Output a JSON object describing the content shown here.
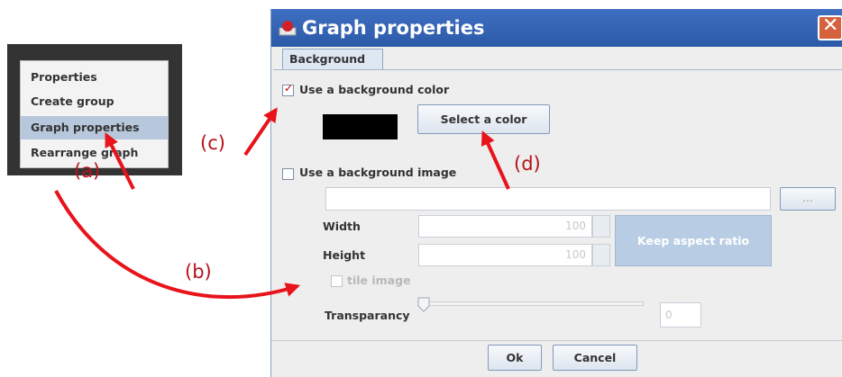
{
  "context_menu": {
    "items": [
      {
        "label": "Properties"
      },
      {
        "label": "Create group"
      },
      {
        "label": "Graph properties",
        "selected": true
      },
      {
        "label": "Rearrange graph"
      }
    ]
  },
  "dialog": {
    "title": "Graph properties",
    "close_icon": "close-icon",
    "tab_label": "Background",
    "use_bg_color": {
      "label": "Use a background color",
      "checked": true
    },
    "bg_color": "#000000",
    "select_color_label": "Select a color",
    "use_bg_image": {
      "label": "Use a background image",
      "checked": false
    },
    "image_path": {
      "value": ""
    },
    "browse_label": "...",
    "width": {
      "label": "Width",
      "value": "100"
    },
    "height": {
      "label": "Height",
      "value": "100"
    },
    "keep_aspect_label": "Keep aspect ratio",
    "tile_image": {
      "label": "tile image",
      "checked": false
    },
    "transparency": {
      "label": "Transparancy",
      "value": "0"
    },
    "ok_label": "Ok",
    "cancel_label": "Cancel"
  },
  "annotations": {
    "a": "(a)",
    "b": "(b)",
    "c": "(c)",
    "d": "(d)",
    "arrow_color": "#e8131b"
  }
}
